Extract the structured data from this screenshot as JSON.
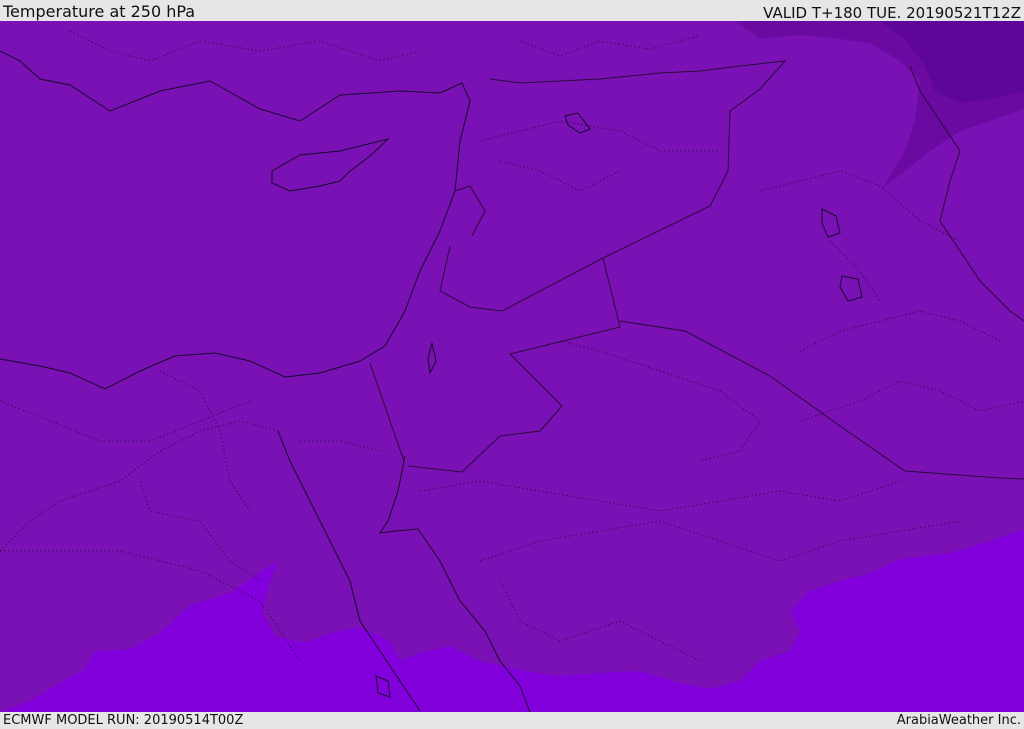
{
  "header": {
    "title": "Temperature at 250 hPa",
    "valid": "VALID T+180 TUE. 20190521T12Z"
  },
  "footer": {
    "model_run": "ECMWF MODEL RUN: 20190514T00Z",
    "credit": "ArabiaWeather Inc."
  },
  "map": {
    "colors": {
      "main_field": "#7a11b4",
      "warm_band": "#8200dc",
      "cold_region": "#6a0aa0",
      "cold_core": "#5e069a",
      "coast_line": "#1a0a2a",
      "border_line": "#2a0a3a"
    }
  }
}
